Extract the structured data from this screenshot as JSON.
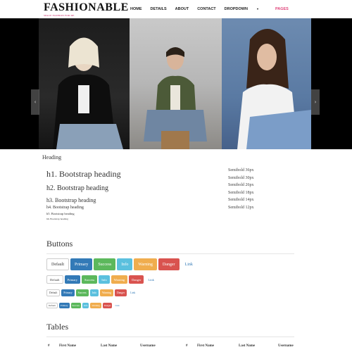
{
  "brand": {
    "title": "FASHIONABLE",
    "subtitle": "SPACE FASHION FOR DE"
  },
  "nav": {
    "items": [
      {
        "label": "HOME"
      },
      {
        "label": "DETAILS"
      },
      {
        "label": "ABOUT"
      },
      {
        "label": "CONTACT"
      },
      {
        "label": "DROPDOWN"
      },
      {
        "label": "PAGES"
      }
    ],
    "active": "PAGES"
  },
  "carousel": {
    "prev_icon": "chevron-left-icon",
    "next_icon": "chevron-right-icon"
  },
  "typography": {
    "label": "Heading",
    "headings": [
      "h1. Bootstrap heading",
      "h2. Bootstrap heading",
      "h3. Bootstrap heading",
      "h4. Bootstrap heading",
      "h5. Bootstrap heading",
      "h6. Bootstrap heading"
    ],
    "semibold": [
      "Semibold 36px",
      "Semibold 30px",
      "Semibold 26px",
      "Semibold 18px",
      "Semibold 14px",
      "Semibold 12px"
    ]
  },
  "buttons": {
    "title": "Buttons",
    "labels": [
      "Default",
      "Primary",
      "Success",
      "Info",
      "Warning",
      "Danger",
      "Link"
    ]
  },
  "tables": {
    "title": "Tables",
    "headers": [
      "#",
      "First Name",
      "Last Name",
      "Username"
    ]
  },
  "colors": {
    "accent": "#e0457b",
    "primary": "#337ab7",
    "success": "#5cb85c",
    "info": "#5bc0de",
    "warning": "#f0ad4e",
    "danger": "#d9534f"
  }
}
